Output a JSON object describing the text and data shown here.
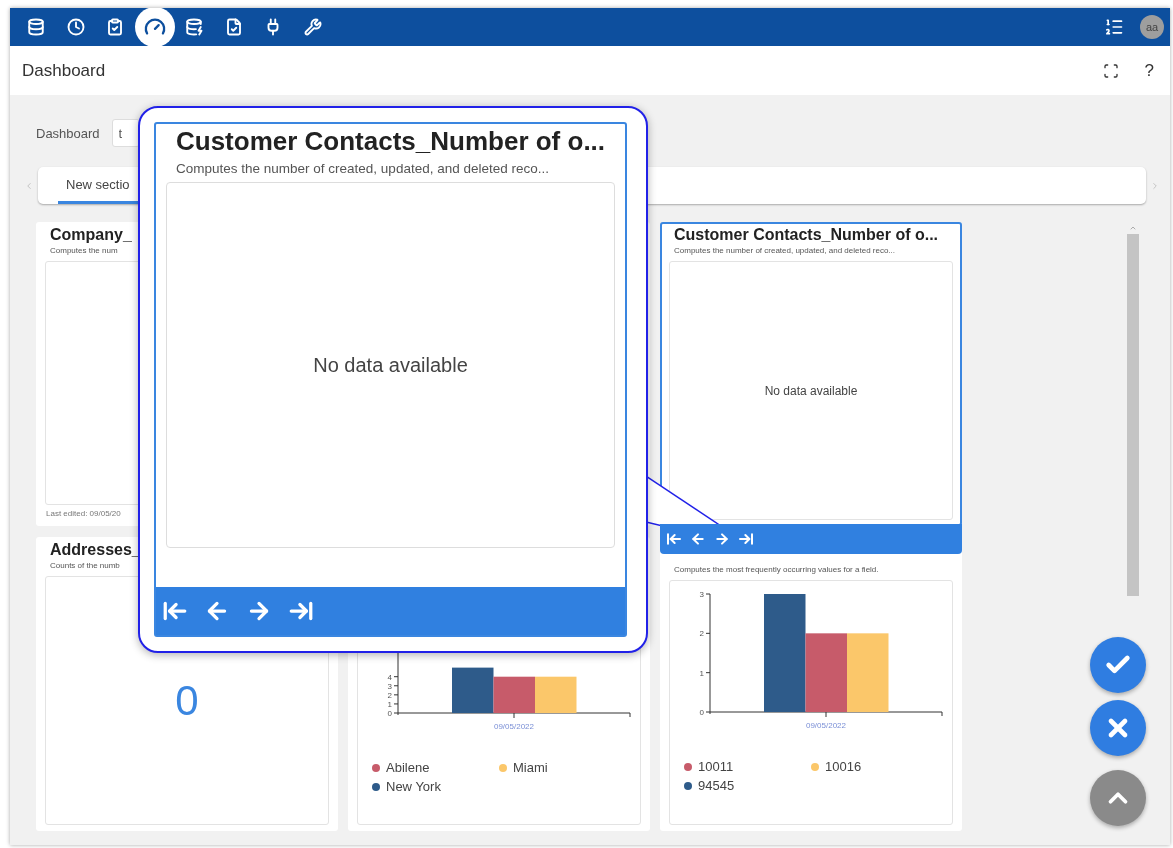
{
  "top_bar": {
    "nav_items": [
      {
        "selected": false
      },
      {
        "selected": false
      },
      {
        "selected": false
      },
      {
        "selected": true
      },
      {
        "selected": false
      },
      {
        "selected": false
      },
      {
        "selected": false
      },
      {
        "selected": false
      }
    ],
    "avatar": "aa"
  },
  "header": {
    "title": "Dashboard",
    "help": "?"
  },
  "dashboard_field": {
    "label": "Dashboard",
    "value": "t"
  },
  "section_tabs": [
    {
      "label": "New sectio",
      "selected": true
    }
  ],
  "cards": [
    {
      "kind": "empty",
      "title": "Company_",
      "subtitle": "Computes the num",
      "footer": "Last edited: 09/05/20",
      "highlighted": false
    },
    {
      "kind": "blank",
      "highlighted": false
    },
    {
      "kind": "no_data",
      "title": "Customer Contacts_Number of o...",
      "subtitle": "Computes the number of created, updated, and deleted reco...",
      "message": "No data available",
      "highlighted": true
    },
    {
      "kind": "number",
      "title": "Addresses_",
      "subtitle": "Counts of the numb",
      "value": "0",
      "highlighted": false
    },
    {
      "kind": "bar_chart",
      "highlighted": false,
      "chart_data": {
        "type": "bar",
        "categories": [
          "09/05/2022"
        ],
        "series": [
          {
            "name": "New York",
            "color": "#2e5b8a",
            "values": [
              5
            ]
          },
          {
            "name": "Abilene",
            "color": "#c75b6a",
            "values": [
              4
            ]
          },
          {
            "name": "Miami",
            "color": "#fbc76a",
            "values": [
              4
            ]
          }
        ],
        "ylim": [
          0,
          13
        ],
        "yticks": [
          0,
          1,
          2,
          3,
          4
        ],
        "legend": "bottom"
      }
    },
    {
      "kind": "bar_chart",
      "subtitle": "Computes the most frequently occurring values for a field.",
      "highlighted": false,
      "chart_data": {
        "type": "bar",
        "categories": [
          "09/05/2022"
        ],
        "series": [
          {
            "name": "94545",
            "color": "#2e5b8a",
            "values": [
              3
            ]
          },
          {
            "name": "10011",
            "color": "#c75b6a",
            "values": [
              2
            ]
          },
          {
            "name": "10016",
            "color": "#fbc76a",
            "values": [
              2
            ]
          }
        ],
        "ylim": [
          0,
          3
        ],
        "yticks": [
          0,
          1,
          2,
          3
        ],
        "legend": "bottom"
      }
    }
  ],
  "magnified_card": {
    "title": "Customer Contacts_Number of o...",
    "subtitle": "Computes the number of created, updated, and deleted reco...",
    "message": "No data available"
  }
}
